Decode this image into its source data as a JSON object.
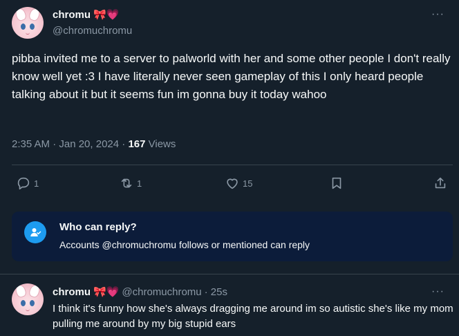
{
  "post": {
    "display_name": "chromu",
    "emoji": "🎀💗",
    "handle": "@chromuchromu",
    "more_label": "···",
    "text": "pibba invited me to a server to palworld with her and some other people I don't really know well yet :3 I have literally never seen gameplay of this I only heard people talking about it but it seems fun im gonna buy it today wahoo",
    "time": "2:35 AM · Jan 20, 2024 · ",
    "views_count": "167",
    "views_label": " Views",
    "actions": {
      "replies": "1",
      "reposts": "1",
      "likes": "15"
    }
  },
  "reply_notice": {
    "title": "Who can reply?",
    "subtitle": "Accounts @chromuchromu follows or mentioned can reply"
  },
  "reply": {
    "display_name": "chromu",
    "emoji": "🎀💗",
    "handle": "@chromuchromu",
    "age": "· 25s",
    "more_label": "···",
    "text": "I think it's funny how she's always dragging me around im so autistic she's like my mom pulling me around by my big stupid ears"
  },
  "colors": {
    "background": "#15202b",
    "accent": "#1d9bf0",
    "notice_bg": "#0c1c3a",
    "secondary_text": "#8b98a5"
  }
}
